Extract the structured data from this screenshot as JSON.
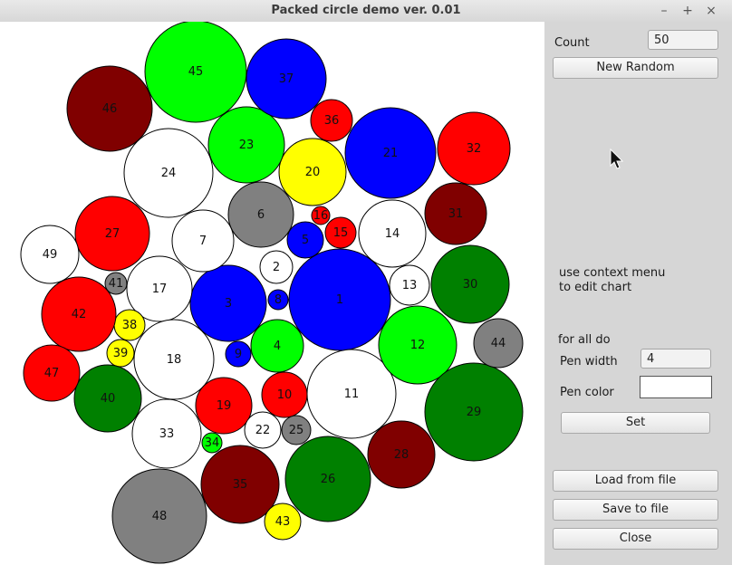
{
  "window": {
    "title": "Packed circle demo ver. 0.01",
    "minimize": "–",
    "maximize": "+",
    "close": "×"
  },
  "panel": {
    "count_label": "Count",
    "count_value": "50",
    "new_random_label": "New Random",
    "hint_line1": "use context menu",
    "hint_line2": "to edit chart",
    "for_all_label": "for all do",
    "pen_width_label": "Pen width",
    "pen_width_value": "4",
    "pen_color_label": "Pen color",
    "pen_color": "#ffffff",
    "set_label": "Set",
    "load_label": "Load from file",
    "save_label": "Save to file",
    "close_label": "Close"
  },
  "colors": {
    "green": "#00ff00",
    "blue": "#0000ff",
    "red": "#ff0000",
    "maroon": "#800000",
    "white": "#ffffff",
    "gray": "#808080",
    "yellow": "#ffff00",
    "darkgreen": "#008000"
  },
  "circles": [
    {
      "id": "1",
      "color": "blue"
    },
    {
      "id": "2",
      "color": "white"
    },
    {
      "id": "3",
      "color": "blue"
    },
    {
      "id": "4",
      "color": "green"
    },
    {
      "id": "5",
      "color": "blue"
    },
    {
      "id": "6",
      "color": "gray"
    },
    {
      "id": "7",
      "color": "white"
    },
    {
      "id": "8",
      "color": "blue"
    },
    {
      "id": "9",
      "color": "blue"
    },
    {
      "id": "10",
      "color": "red"
    },
    {
      "id": "11",
      "color": "white"
    },
    {
      "id": "12",
      "color": "green"
    },
    {
      "id": "13",
      "color": "white"
    },
    {
      "id": "14",
      "color": "white"
    },
    {
      "id": "15",
      "color": "red"
    },
    {
      "id": "16",
      "color": "red"
    },
    {
      "id": "17",
      "color": "white"
    },
    {
      "id": "18",
      "color": "white"
    },
    {
      "id": "19",
      "color": "red"
    },
    {
      "id": "20",
      "color": "yellow"
    },
    {
      "id": "21",
      "color": "blue"
    },
    {
      "id": "22",
      "color": "white"
    },
    {
      "id": "23",
      "color": "green"
    },
    {
      "id": "24",
      "color": "white"
    },
    {
      "id": "25",
      "color": "gray"
    },
    {
      "id": "26",
      "color": "darkgreen"
    },
    {
      "id": "27",
      "color": "red"
    },
    {
      "id": "28",
      "color": "maroon"
    },
    {
      "id": "29",
      "color": "darkgreen"
    },
    {
      "id": "30",
      "color": "darkgreen"
    },
    {
      "id": "31",
      "color": "maroon"
    },
    {
      "id": "32",
      "color": "red"
    },
    {
      "id": "33",
      "color": "white"
    },
    {
      "id": "34",
      "color": "green"
    },
    {
      "id": "35",
      "color": "maroon"
    },
    {
      "id": "36",
      "color": "red"
    },
    {
      "id": "37",
      "color": "blue"
    },
    {
      "id": "38",
      "color": "yellow"
    },
    {
      "id": "39",
      "color": "yellow"
    },
    {
      "id": "40",
      "color": "darkgreen"
    },
    {
      "id": "41",
      "color": "gray"
    },
    {
      "id": "42",
      "color": "red"
    },
    {
      "id": "43",
      "color": "yellow"
    },
    {
      "id": "44",
      "color": "gray"
    },
    {
      "id": "45",
      "color": "green"
    },
    {
      "id": "46",
      "color": "maroon"
    },
    {
      "id": "47",
      "color": "red"
    },
    {
      "id": "48",
      "color": "gray"
    },
    {
      "id": "49",
      "color": "white"
    },
    {
      "id": "50",
      "color": "blue"
    }
  ]
}
